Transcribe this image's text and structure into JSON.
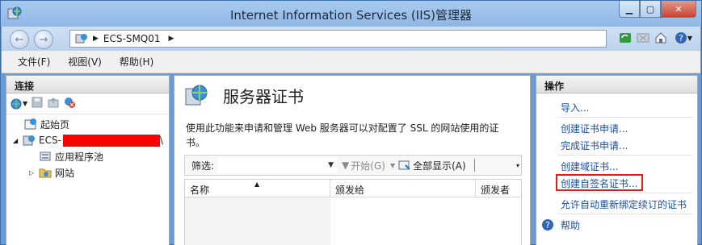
{
  "window": {
    "title": "Internet Information Services (IIS)管理器"
  },
  "address": {
    "server": "ECS-SMQ01"
  },
  "menu": [
    "文件(F)",
    "视图(V)",
    "帮助(H)"
  ],
  "connections": {
    "header": "连接",
    "tree": {
      "start_page": "起始页",
      "server": "ECS-",
      "server_suffix": "\\",
      "app_pools": "应用程序池",
      "sites": "网站"
    }
  },
  "center": {
    "title": "服务器证书",
    "description": "使用此功能来申请和管理 Web 服务器可以对配置了 SSL 的网站使用的证书。",
    "filter_label": "筛选:",
    "start_button": "开始(G)",
    "show_all_button": "全部显示(A)",
    "columns": [
      "名称",
      "颁发给",
      "颁发者"
    ]
  },
  "actions": {
    "header": "操作",
    "import": "导入...",
    "create_request": "创建证书申请...",
    "complete_request": "完成证书申请...",
    "create_domain": "创建域证书...",
    "create_self_signed": "创建自签名证书...",
    "auto_rebind": "允许自动重新绑定续订的证书",
    "help": "帮助"
  },
  "colors": {
    "link": "#1a4fa3",
    "highlight_box": "#d92020",
    "redaction": "#ff0000"
  }
}
